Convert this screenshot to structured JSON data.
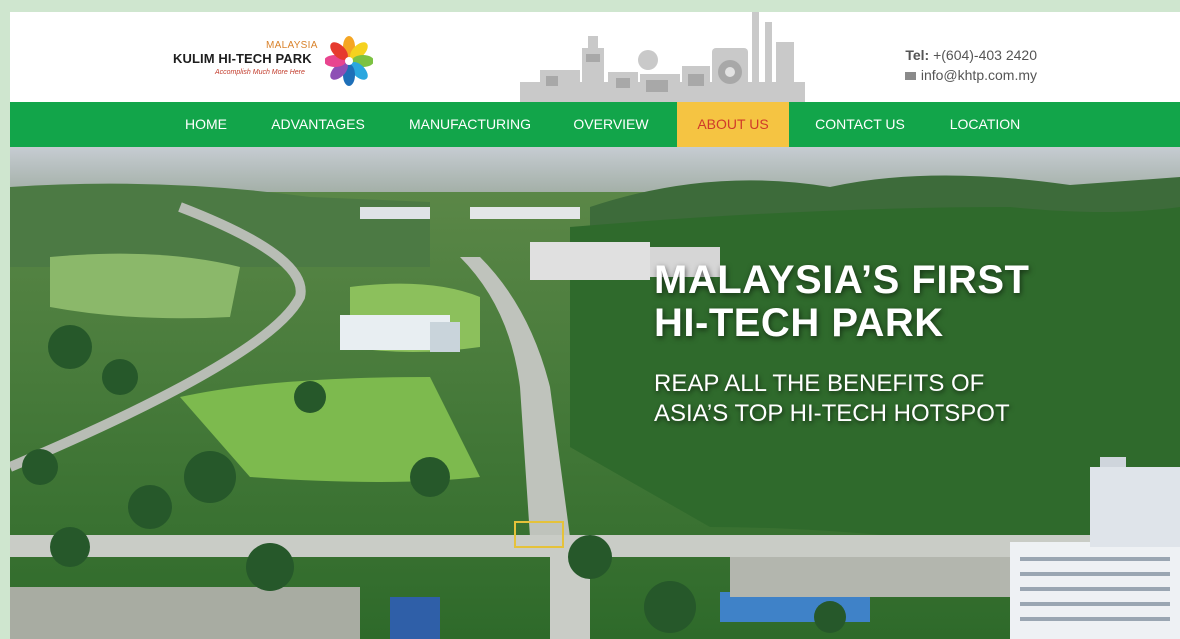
{
  "brand": {
    "country": "MALAYSIA",
    "name": "KULIM HI-TECH PARK",
    "tagline": "Accomplish Much More Here",
    "flower_colors": [
      "#e63a2e",
      "#f5a623",
      "#f5d21f",
      "#7cc242",
      "#2aa7df",
      "#8e4fb5",
      "#e8458f",
      "#1e6fb8"
    ]
  },
  "contact": {
    "tel_label": "Tel:",
    "tel_value": "+(604)-403 2420",
    "email": "info@khtp.com.my",
    "email_icon": "envelope-icon"
  },
  "nav": {
    "items": [
      {
        "label": "HOME"
      },
      {
        "label": "ADVANTAGES"
      },
      {
        "label": "MANUFACTURING"
      },
      {
        "label": "OVERVIEW"
      },
      {
        "label": "ABOUT US",
        "active": true
      },
      {
        "label": "CONTACT US"
      },
      {
        "label": "LOCATION"
      }
    ],
    "bar_color": "#12a54a",
    "active_color": "#f5c442",
    "active_text_color": "#d03a2a"
  },
  "hero": {
    "title_line1": "MALAYSIA’S FIRST",
    "title_line2": "HI-TECH PARK",
    "sub_line1": "REAP ALL THE BENEFITS OF",
    "sub_line2": "ASIA’S TOP HI-TECH HOTSPOT"
  }
}
